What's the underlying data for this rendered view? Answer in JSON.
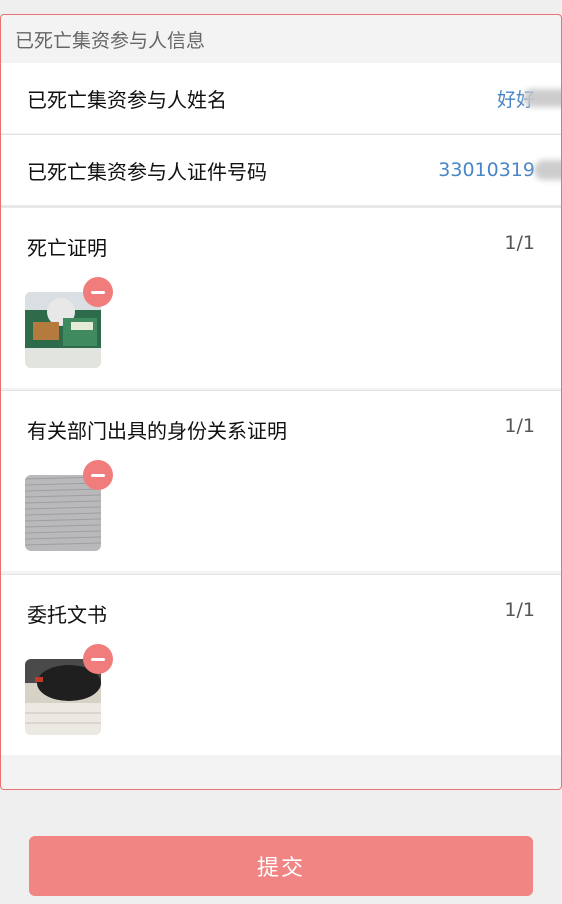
{
  "section": {
    "title": "已死亡集资参与人信息"
  },
  "fields": {
    "name_label": "已死亡集资参与人姓名",
    "name_value": "好好",
    "id_label": "已死亡集资参与人证件号码",
    "id_value": "33010319"
  },
  "uploads": [
    {
      "title": "死亡证明",
      "count": "1/1",
      "image": "photo-box-icon"
    },
    {
      "title": "有关部门出具的身份关系证明",
      "count": "1/1",
      "image": "lined-paper-icon"
    },
    {
      "title": "委托文书",
      "count": "1/1",
      "image": "mouse-photo-icon"
    }
  ],
  "actions": {
    "submit_label": "提交"
  },
  "colors": {
    "accent": "#f08583",
    "value_blue": "#4a86c5",
    "remove_red": "#f07c7c",
    "border_red": "#e57373"
  }
}
